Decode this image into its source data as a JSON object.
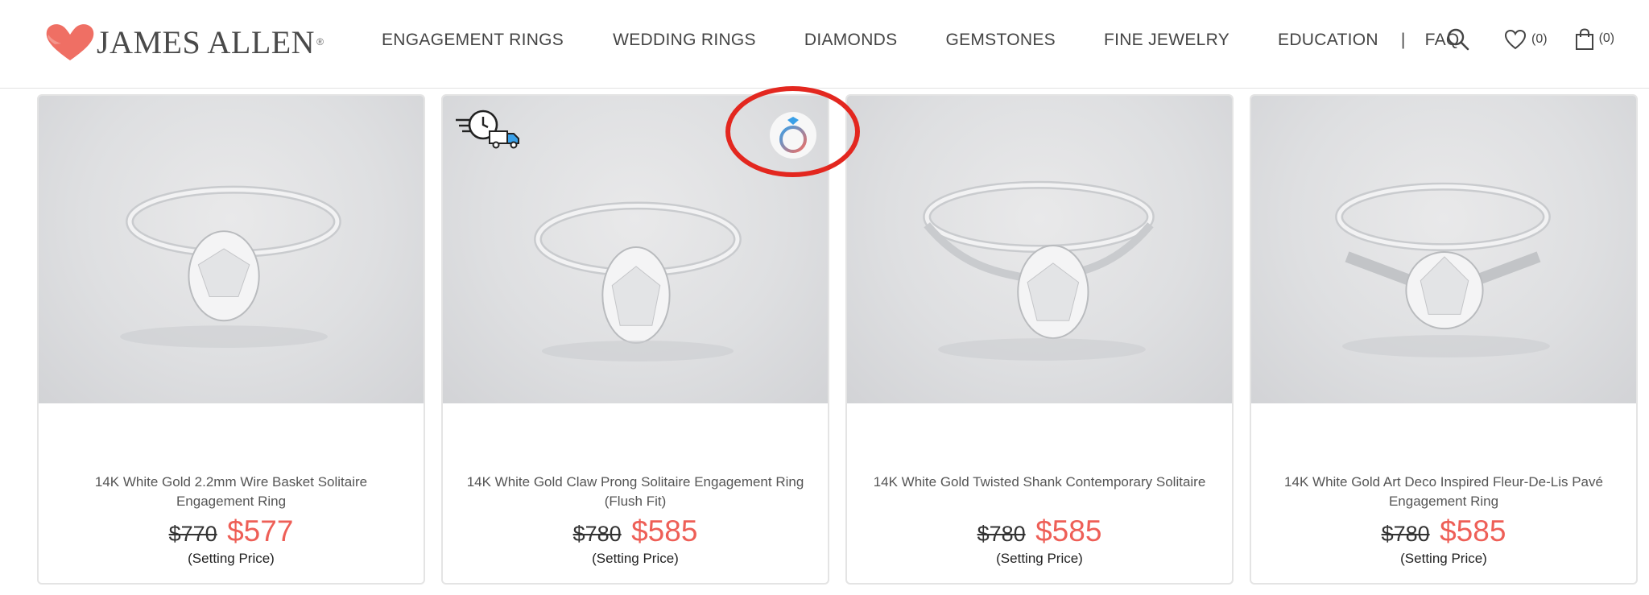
{
  "brand": {
    "name": "JAMES ALLEN",
    "reg": "®",
    "heart_color": "#ef6f64"
  },
  "nav": {
    "items": [
      "ENGAGEMENT RINGS",
      "WEDDING RINGS",
      "DIAMONDS",
      "GEMSTONES",
      "FINE JEWELRY",
      "EDUCATION"
    ],
    "separator": "|",
    "faq": "FAQ"
  },
  "header_icons": {
    "search": "search-icon",
    "wishlist_count": "(0)",
    "cart_count": "(0)"
  },
  "products": [
    {
      "title": "14K White Gold 2.2mm Wire Basket Solitaire Engagement Ring",
      "old_price": "$770",
      "new_price": "$577",
      "price_note": "(Setting Price)"
    },
    {
      "title": "14K White Gold Claw Prong Solitaire Engagement Ring (Flush Fit)",
      "old_price": "$780",
      "new_price": "$585",
      "price_note": "(Setting Price)",
      "badges": [
        "fast-shipping-icon",
        "ring-360-view-icon"
      ]
    },
    {
      "title": "14K White Gold Twisted Shank Contemporary Solitaire",
      "old_price": "$780",
      "new_price": "$585",
      "price_note": "(Setting Price)"
    },
    {
      "title": "14K White Gold Art Deco Inspired Fleur-De-Lis Pavé Engagement Ring",
      "old_price": "$780",
      "new_price": "$585",
      "price_note": "(Setting Price)"
    }
  ],
  "colors": {
    "sale_red": "#ee5f57",
    "annotation_red": "#e3271f",
    "accent_blue": "#3aa0e8"
  }
}
